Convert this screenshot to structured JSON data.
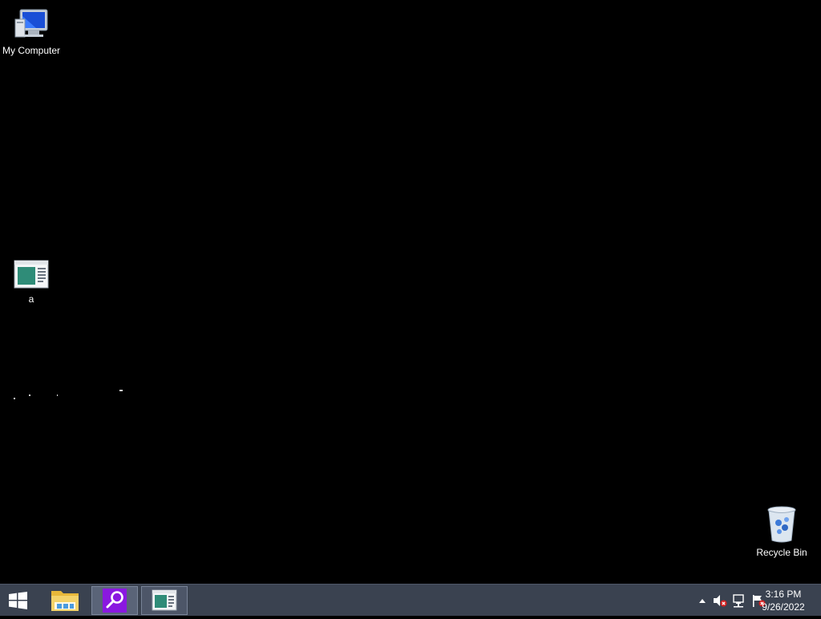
{
  "desktop": {
    "icons": [
      {
        "label": "My Computer",
        "icon": "computer-icon"
      },
      {
        "label": "a",
        "icon": "window-app-icon"
      },
      {
        "label": "Recycle Bin",
        "icon": "recycle-bin-icon"
      }
    ],
    "background_color": "#000000"
  },
  "taskbar": {
    "background_color": "#3a4250",
    "buttons": [
      {
        "name": "start",
        "icon": "windows-logo-icon"
      },
      {
        "name": "file-explorer",
        "icon": "folder-icon"
      },
      {
        "name": "search",
        "icon": "magnifier-icon",
        "accent": "#8a18e0"
      },
      {
        "name": "app-window",
        "icon": "window-app-icon"
      }
    ],
    "tray": {
      "icons": [
        "show-hidden-icons-arrow",
        "speaker-muted-icon",
        "network-icon",
        "action-center-flag-icon"
      ]
    },
    "clock": {
      "time": "3:16 PM",
      "date": "9/26/2022"
    }
  }
}
